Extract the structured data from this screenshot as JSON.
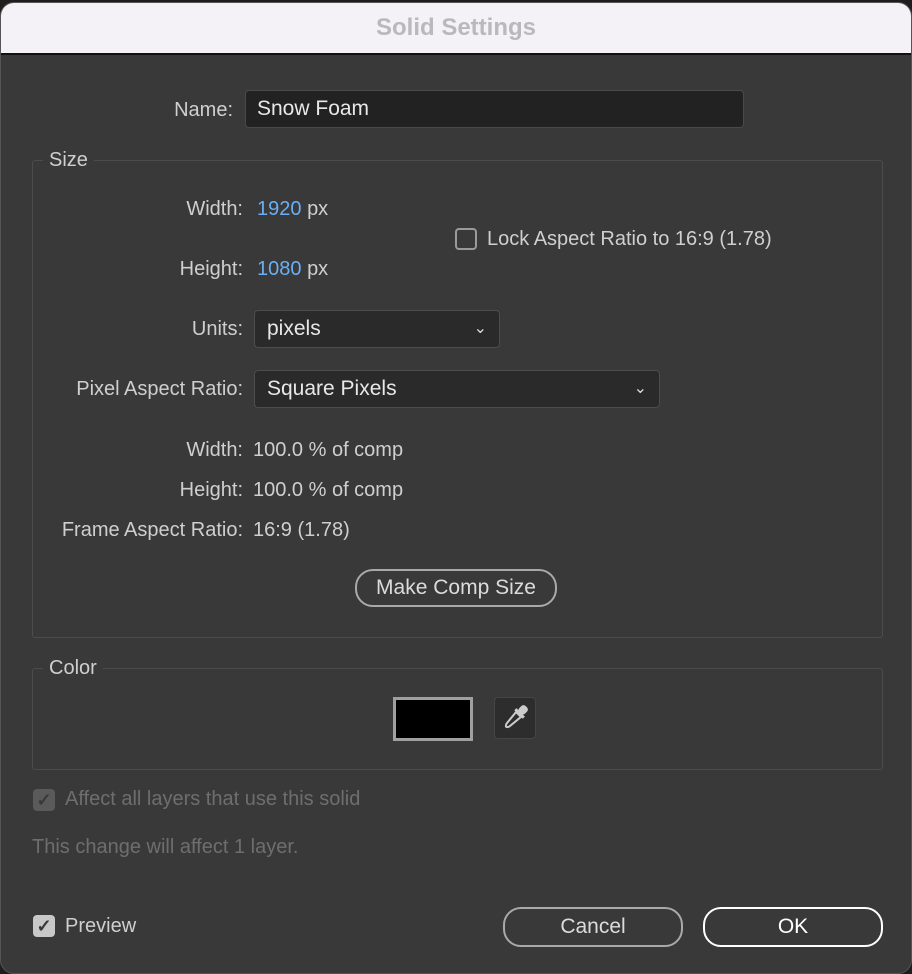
{
  "title": "Solid Settings",
  "name": {
    "label": "Name:",
    "value": "Snow Foam"
  },
  "size": {
    "title": "Size",
    "width_label": "Width:",
    "width_value": "1920",
    "height_label": "Height:",
    "height_value": "1080",
    "unit": "px",
    "lock_label": "Lock Aspect Ratio to 16:9 (1.78)",
    "lock_checked": false,
    "units_label": "Units:",
    "units_value": "pixels",
    "par_label": "Pixel Aspect Ratio:",
    "par_value": "Square Pixels",
    "width_pct_label": "Width:",
    "width_pct": "100.0 % of comp",
    "height_pct_label": "Height:",
    "height_pct": "100.0 % of comp",
    "far_label": "Frame Aspect Ratio:",
    "far_value": "16:9 (1.78)",
    "make_comp_size": "Make Comp Size"
  },
  "color": {
    "title": "Color",
    "swatch": "#000000"
  },
  "affect_label": "Affect all layers that use this solid",
  "affect_checked": true,
  "change_note": "This change will affect 1 layer.",
  "preview_label": "Preview",
  "preview_checked": true,
  "cancel": "Cancel",
  "ok": "OK"
}
